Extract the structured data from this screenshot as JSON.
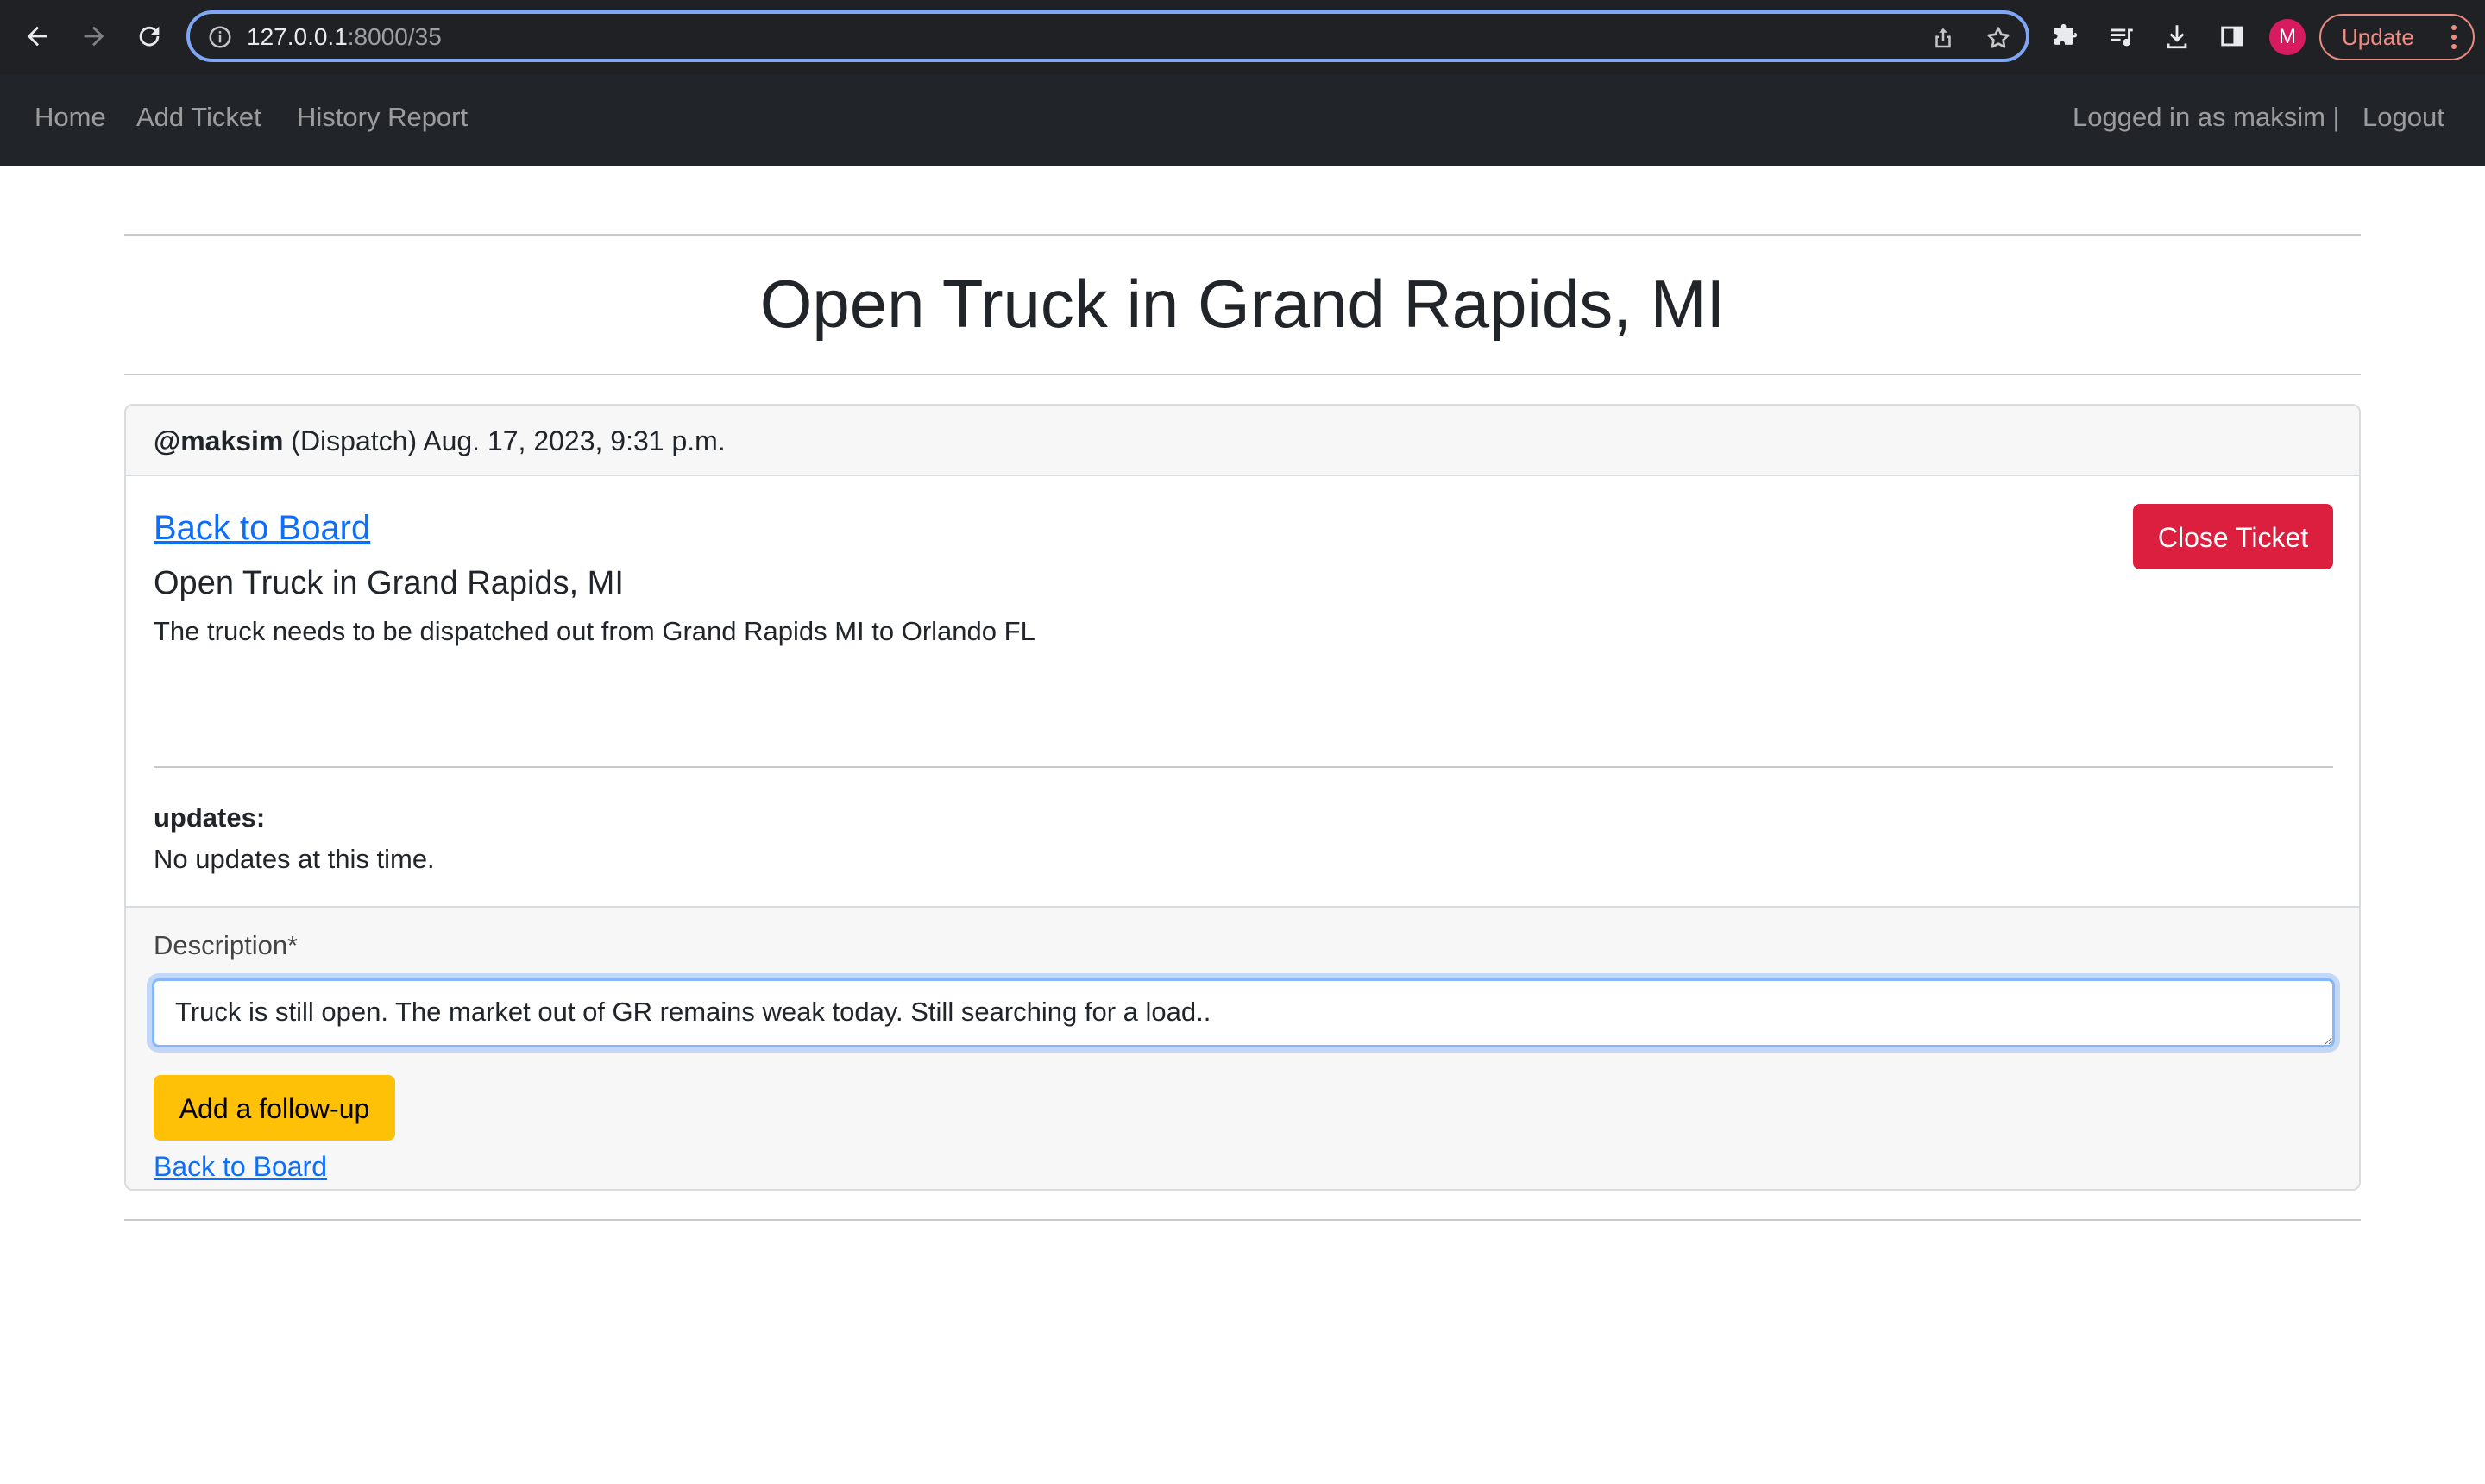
{
  "browser": {
    "url_host": "127.0.0.1",
    "url_path": ":8000/35",
    "profile_initial": "M",
    "update_label": "Update"
  },
  "navbar": {
    "links": [
      {
        "label": "Home"
      },
      {
        "label": "Add Ticket"
      },
      {
        "label": "History Report"
      }
    ],
    "logged_in_text": "Logged in as maksim |",
    "logout_label": "Logout"
  },
  "page": {
    "title": "Open Truck in Grand Rapids, MI"
  },
  "ticket": {
    "author": "@maksim",
    "role": "(Dispatch)",
    "timestamp": "Aug. 17, 2023, 9:31 p.m.",
    "back_label": "Back to Board",
    "title": "Open Truck in Grand Rapids, MI",
    "description": "The truck needs to be dispatched out from Grand Rapids MI to Orlando FL",
    "close_label": "Close Ticket",
    "updates_label": "updates:",
    "updates_text": "No updates at this time."
  },
  "followup_form": {
    "description_label": "Description*",
    "description_value": "Truck is still open. The market out of GR remains weak today. Still searching for a load..",
    "submit_label": "Add a follow-up",
    "back_label": "Back to Board"
  },
  "colors": {
    "accent": "#0d6efd",
    "danger": "#dc1f3e",
    "warning": "#ffc107",
    "navbar": "#212529"
  }
}
